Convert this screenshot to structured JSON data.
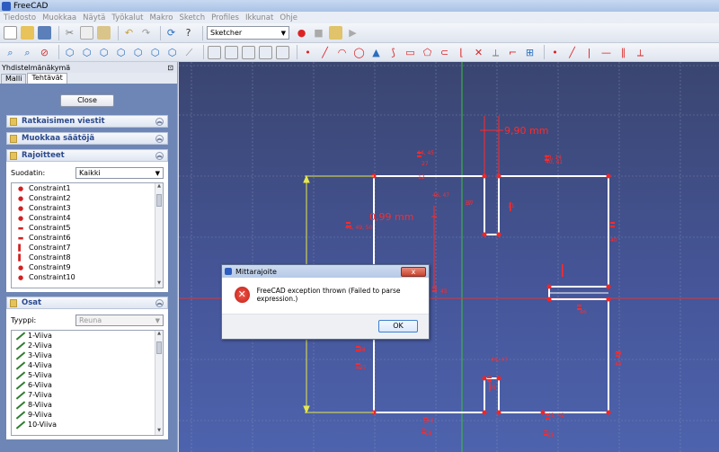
{
  "window": {
    "title": "FreeCAD"
  },
  "menu": [
    "Tiedosto",
    "Muokkaa",
    "Näytä",
    "Työkalut",
    "Makro",
    "Sketch",
    "Profiles",
    "Ikkunat",
    "Ohje"
  ],
  "toolbar": {
    "workbench": "Sketcher"
  },
  "panel": {
    "title": "Yhdistelmänäkymä",
    "tabs": [
      "Malli",
      "Tehtävät"
    ],
    "close_label": "Close",
    "sections": {
      "solver": "Ratkaisimen viestit",
      "edit": "Muokkaa säätöjä",
      "constraints": "Rajoitteet",
      "elements": "Osat"
    },
    "filter_label": "Suodatin:",
    "filter_value": "Kaikki",
    "constraints": [
      {
        "label": "Constraint1",
        "kind": "dot"
      },
      {
        "label": "Constraint2",
        "kind": "dot"
      },
      {
        "label": "Constraint3",
        "kind": "dot"
      },
      {
        "label": "Constraint4",
        "kind": "dot"
      },
      {
        "label": "Constraint5",
        "kind": "hbar"
      },
      {
        "label": "Constraint6",
        "kind": "hbar"
      },
      {
        "label": "Constraint7",
        "kind": "vbar"
      },
      {
        "label": "Constraint8",
        "kind": "vbar"
      },
      {
        "label": "Constraint9",
        "kind": "dot"
      },
      {
        "label": "Constraint10",
        "kind": "dot"
      }
    ],
    "type_label": "Tyyppi:",
    "type_value": "Reuna",
    "elements": [
      "1-Viiva",
      "2-Viiva",
      "3-Viiva",
      "4-Viiva",
      "5-Viiva",
      "6-Viiva",
      "7-Viiva",
      "8-Viiva",
      "9-Viiva",
      "10-Viiva"
    ]
  },
  "canvas": {
    "dim_labels": [
      {
        "text": "9,90 mm",
        "size": 11
      },
      {
        "text": "0,99 mm",
        "size": 11
      },
      {
        "text": "46, 47",
        "size": 6
      },
      {
        "text": "48, 49, 50",
        "size": 6
      },
      {
        "text": "44, 45",
        "size": 6
      },
      {
        "text": "13, 14",
        "size": 6
      },
      {
        "text": "12",
        "size": 6
      },
      {
        "text": "40",
        "size": 6
      },
      {
        "text": "46",
        "size": 6
      },
      {
        "text": "45",
        "size": 6
      },
      {
        "text": "38",
        "size": 6
      },
      {
        "text": "27",
        "size": 6
      },
      {
        "text": "49",
        "size": 6
      },
      {
        "text": "48",
        "size": 6
      },
      {
        "text": "26",
        "size": 6
      },
      {
        "text": "40, 47",
        "size": 6
      },
      {
        "text": "43",
        "size": 6
      },
      {
        "text": "28",
        "size": 6
      },
      {
        "text": "43, 42",
        "size": 6
      },
      {
        "text": "28",
        "size": 6
      },
      {
        "text": "37",
        "size": 6
      },
      {
        "text": "37",
        "size": 6
      },
      {
        "text": "11",
        "size": 6
      },
      {
        "text": "40, 41",
        "size": 6
      },
      {
        "text": "27",
        "size": 6
      }
    ]
  },
  "dialog": {
    "title": "Mittarajoite",
    "message": "FreeCAD exception thrown (Failed to parse expression.)",
    "ok": "OK",
    "close": "x"
  }
}
